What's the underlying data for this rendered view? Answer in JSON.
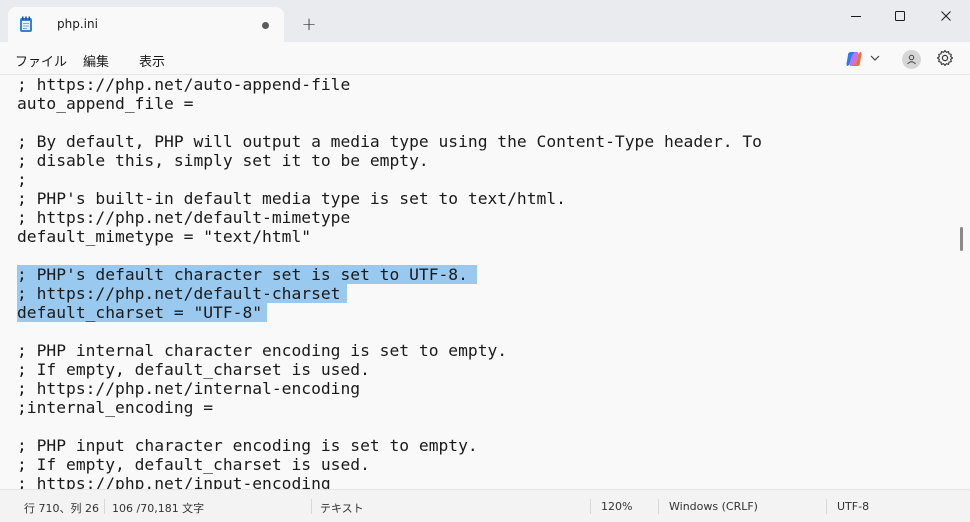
{
  "tab": {
    "title": "php.ini",
    "icon": "notepad-icon",
    "new_tab_label": "+"
  },
  "menu": {
    "file": "ファイル",
    "edit": "編集",
    "view": "表示"
  },
  "editor": {
    "lines": [
      "; https://php.net/auto-append-file",
      "auto_append_file =",
      "",
      "; By default, PHP will output a media type using the Content-Type header. To",
      "; disable this, simply set it to be empty.",
      ";",
      "; PHP's built-in default media type is set to text/html.",
      "; https://php.net/default-mimetype",
      "default_mimetype = \"text/html\"",
      "",
      "; PHP's default character set is set to UTF-8.",
      "; https://php.net/default-charset",
      "default_charset = \"UTF-8\"",
      "",
      "; PHP internal character encoding is set to empty.",
      "; If empty, default_charset is used.",
      "; https://php.net/internal-encoding",
      ";internal_encoding =",
      "",
      "; PHP input character encoding is set to empty.",
      "; If empty, default_charset is used.",
      "; https://php.net/input-encoding"
    ],
    "selected_lines": [
      10,
      11,
      12
    ]
  },
  "status": {
    "position": "行 710、列 26",
    "count": "106 /70,181 文字",
    "format": "テキスト",
    "zoom": "120%",
    "line_ending": "Windows (CRLF)",
    "encoding": "UTF-8"
  },
  "colors": {
    "selection": "#99c9ef",
    "background": "#f9f9f9",
    "titlebar": "#e9ebee"
  }
}
